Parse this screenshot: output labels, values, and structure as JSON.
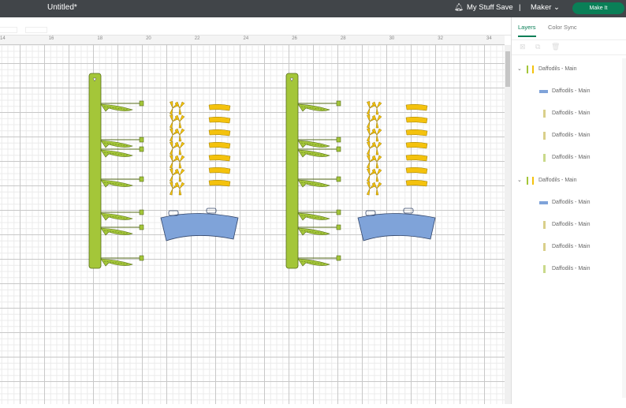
{
  "topbar": {
    "title": "Untitled*",
    "my_stuff": "My Stuff",
    "save": "Save",
    "separator": "|",
    "machine": "Maker",
    "make_it": "Make It"
  },
  "ruler": {
    "labels": [
      "14",
      "16",
      "18",
      "20",
      "22",
      "24",
      "26",
      "28",
      "30",
      "32",
      "34"
    ]
  },
  "panel": {
    "tabs": [
      "Layers",
      "Color Sync"
    ],
    "groups": [
      {
        "name": "Daffodils - Main",
        "children": [
          "Daffodils - Main",
          "Daffodils - Main",
          "Daffodils - Main",
          "Daffodils - Main"
        ]
      },
      {
        "name": "Daffodils - Main",
        "children": [
          "Daffodils - Main",
          "Daffodils - Main",
          "Daffodils - Main",
          "Daffodils - Main"
        ]
      }
    ]
  },
  "colors": {
    "stem": "#a4c639",
    "petal": "#f4c20d",
    "vase": "#7fa3d9",
    "accent": "#0a7f57",
    "topbar": "#414549"
  }
}
